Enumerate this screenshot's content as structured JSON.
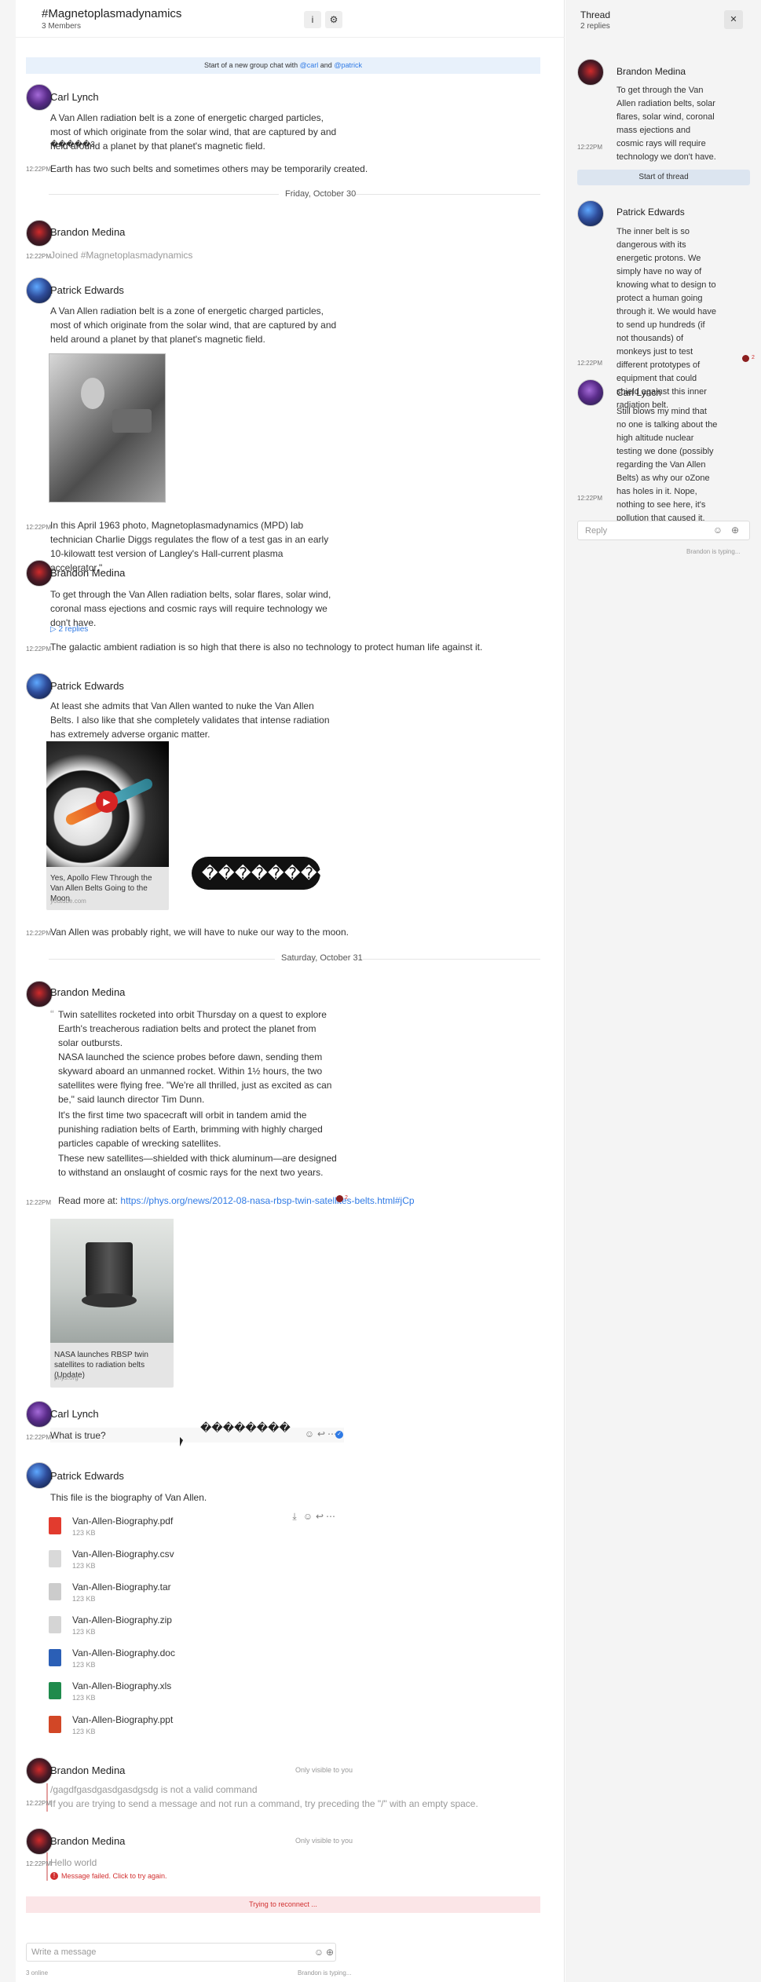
{
  "header": {
    "title": "#Magnetoplasmadynamics",
    "members": "3 Members",
    "info_icon": "i",
    "settings_icon": "⚙"
  },
  "banner": {
    "prefix": "Start of a new group chat with",
    "carl": "@carl",
    "and": "and",
    "patrick": "@patrick"
  },
  "messages": {
    "m1": {
      "name": "Carl Lynch",
      "text1": "A Van Allen radiation belt is a zone of energetic charged particles, most of which originate from the solar wind, that are captured by and held around a planet by that planet's magnetic field.",
      "glyphs": "�����3",
      "time": "12:22PM",
      "text2": "Earth has two such belts and sometimes others may be temporarily created."
    },
    "date1": "Friday, October 30",
    "m2": {
      "name": "Brandon Medina",
      "time": "12:22PM",
      "text": "Joined #Magnetoplasmadynamics"
    },
    "m3": {
      "name": "Patrick Edwards",
      "text": "A Van Allen radiation belt is a zone of energetic charged particles, most of which originate from the solar wind, that are captured by and held around a planet by that planet's magnetic field.",
      "time": "12:22PM",
      "caption": "In this April 1963 photo, Magnetoplasmadynamics (MPD) lab technician Charlie Diggs regulates the flow of a test gas in an early 10-kilowatt test version of Langley's Hall-current plasma accelerator.\""
    },
    "m4": {
      "name": "Brandon Medina",
      "text": "To get through the Van Allen radiation belts, solar flares, solar wind, coronal mass ejections and cosmic rays will require technology we don't have.",
      "replies": "2 replies",
      "time": "12:22PM",
      "text2": "The galactic ambient radiation is so high that there is also no technology to protect human life against it."
    },
    "m5": {
      "name": "Patrick Edwards",
      "text": "At least she admits that Van Allen wanted to nuke the Van Allen Belts. I also like that she completely validates that intense radiation has extremely adverse organic matter.",
      "card_title": "Yes, Apollo Flew Through the Van Allen Belts Going to the Moon",
      "card_source": "youtube.com",
      "time": "12:22PM",
      "text2": "Van Allen was probably right, we will have to nuke our way to the moon."
    },
    "date2": "Saturday, October 31",
    "m6": {
      "name": "Brandon Medina",
      "q1": "Twin satellites rocketed into orbit Thursday on a quest to explore Earth's treacherous radiation belts and protect the planet from solar outbursts.",
      "q2": "NASA launched the science probes before dawn, sending them skyward aboard an unmanned rocket. Within 1½ hours, the two satellites were flying free. \"We're all thrilled, just as excited as can be,\" said launch director Tim Dunn.",
      "q3": "It's the first time two spacecraft will orbit in tandem amid the punishing radiation belts of Earth, brimming with highly charged particles capable of wrecking satellites.",
      "q4": "These new satellites—shielded with thick aluminum—are designed to withstand an onslaught of cosmic rays for the next two years.",
      "time": "12:22PM",
      "read_more": "Read more at:",
      "url": "https://phys.org/news/2012-08-nasa-rbsp-twin-satellites-belts.html#jCp",
      "reply_count": "2",
      "card_title": "NASA launches RBSP twin satellites to radiation belts (Update)",
      "card_source": "phys.org"
    },
    "m7": {
      "name": "Carl Lynch",
      "time": "12:22PM",
      "text": "What is true?",
      "pill": "��������",
      "pill2": "��������"
    },
    "m8": {
      "name": "Patrick Edwards",
      "text": "This file is the biography of Van Allen."
    },
    "files": [
      {
        "name": "Van-Allen-Biography.pdf",
        "size": "123 KB",
        "color": "#e23b2e"
      },
      {
        "name": "Van-Allen-Biography.csv",
        "size": "123 KB",
        "color": "#d9d9d9"
      },
      {
        "name": "Van-Allen-Biography.tar",
        "size": "123 KB",
        "color": "#cccccc"
      },
      {
        "name": "Van-Allen-Biography.zip",
        "size": "123 KB",
        "color": "#d5d5d5"
      },
      {
        "name": "Van-Allen-Biography.doc",
        "size": "123 KB",
        "color": "#2b5fb6"
      },
      {
        "name": "Van-Allen-Biography.xls",
        "size": "123 KB",
        "color": "#1f8b4c"
      },
      {
        "name": "Van-Allen-Biography.ppt",
        "size": "123 KB",
        "color": "#d24726"
      }
    ],
    "m9": {
      "name": "Brandon Medina",
      "visibility": "Only visible to you",
      "time": "12:22PM",
      "text": "/gagdfgasdgasdgasdgsdg is not a valid command",
      "help": "If you are trying to send a message and not run a command, try preceding the \"/\" with an empty space."
    },
    "m10": {
      "name": "Brandon Medina",
      "visibility": "Only visible to you",
      "time": "12:22PM",
      "text": "Hello world",
      "error": "Message failed. Click to try again."
    }
  },
  "reconnect": "Trying to reconnect ...",
  "composer": {
    "placeholder": "Write a message",
    "online": "3 online",
    "typing": "Brandon is typing..."
  },
  "thread": {
    "title": "Thread",
    "replies": "2 replies",
    "close_icon": "✕",
    "parent": {
      "name": "Brandon Medina",
      "text": "To get through the Van Allen radiation belts, solar flares, solar wind, coronal mass ejections and cosmic rays will require technology we don't have.",
      "time": "12:22PM"
    },
    "start": "Start of thread",
    "r1": {
      "name": "Patrick Edwards",
      "text": "The inner belt is so dangerous with its energetic protons. We simply have no way of knowing what to design to protect a human going through it. We would have to send up hundreds (if not thousands) of monkeys just to test different prototypes of equipment that could shield against this inner radiation belt.",
      "time": "12:22PM",
      "count": "2"
    },
    "r2": {
      "name": "Carl Lynch",
      "text": "Still blows my mind that no one is talking about the high altitude nuclear testing we done (possibly regarding the Van Allen Belts) as why our oZone has holes in it. Nope, nothing to see here, it's pollution that caused it.",
      "time": "12:22PM"
    },
    "reply_placeholder": "Reply",
    "typing": "Brandon is typing..."
  }
}
